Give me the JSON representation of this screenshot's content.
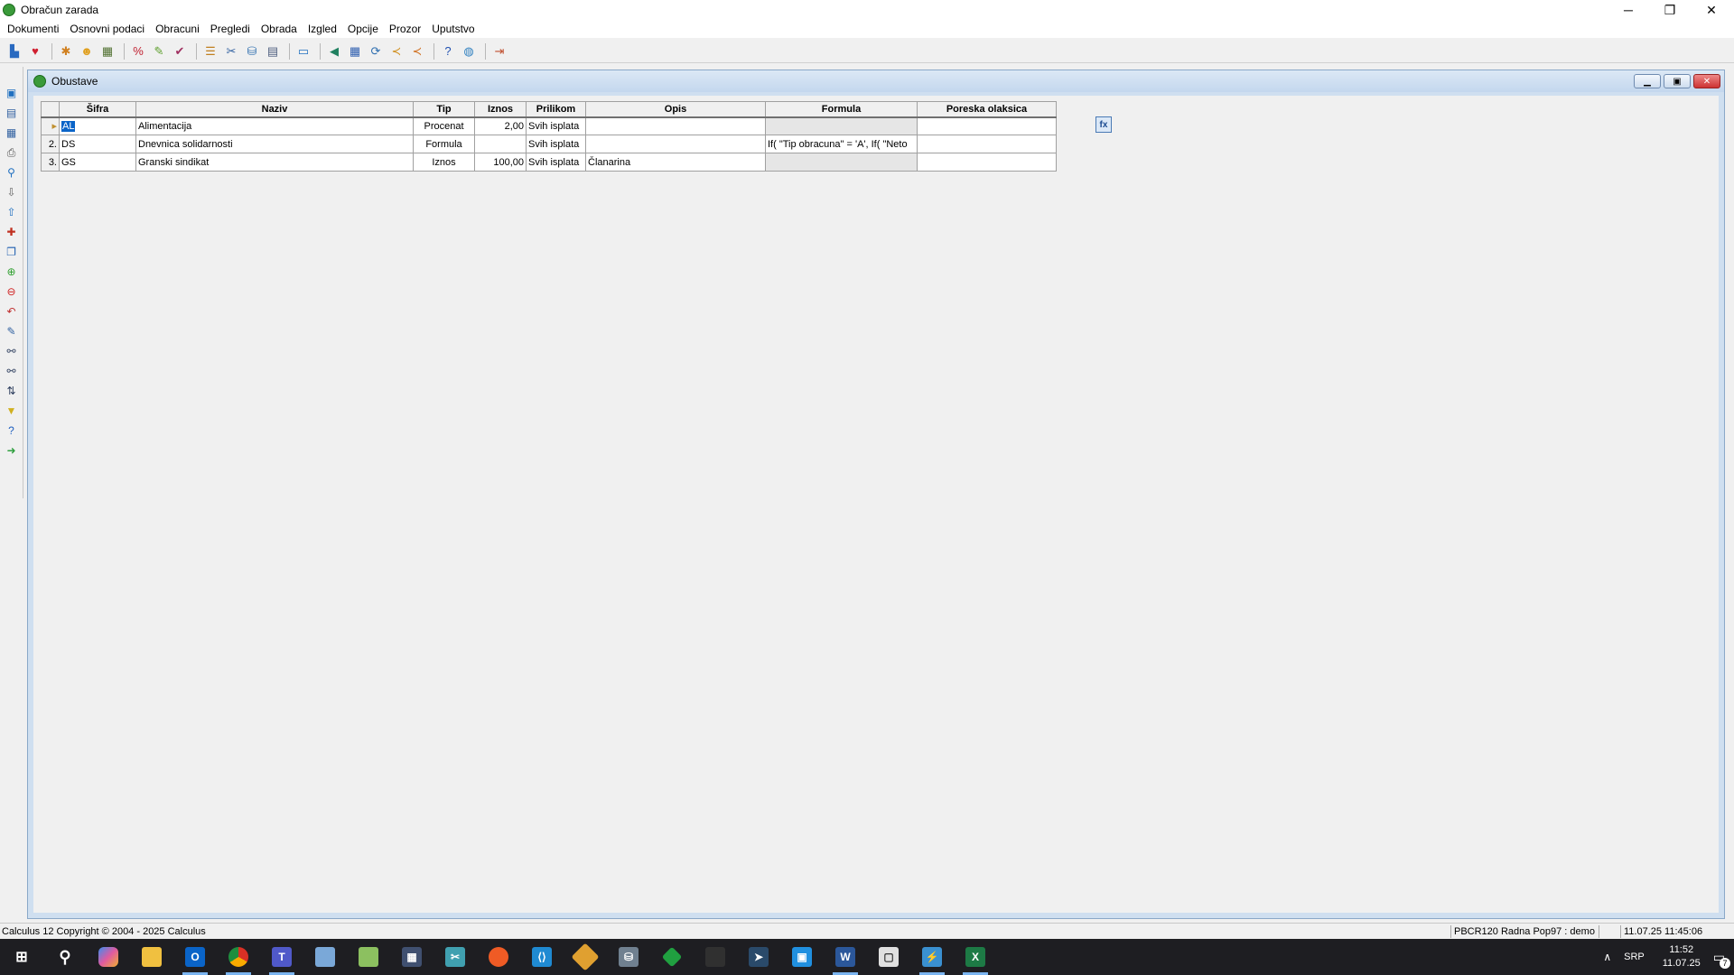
{
  "window": {
    "title": "Obračun zarada",
    "minimize_icon": "─",
    "restore_icon": "❐",
    "close_icon": "✕"
  },
  "menu": [
    "Dokumenti",
    "Osnovni podaci",
    "Obracuni",
    "Pregledi",
    "Obrada",
    "Izgled",
    "Opcije",
    "Prozor",
    "Uputstvo"
  ],
  "child_window": {
    "title": "Obustave",
    "columns": [
      "Šifra",
      "Naziv",
      "Tip",
      "Iznos",
      "Prilikom",
      "Opis",
      "Formula",
      "Poreska olaksica"
    ],
    "rows": [
      {
        "num": "",
        "sifra": "AL",
        "naziv": "Alimentacija",
        "tip": "Procenat",
        "iznos": "2,00",
        "prilikom": "Svih isplata",
        "opis": "",
        "formula": "",
        "poreska": ""
      },
      {
        "num": "2.",
        "sifra": "DS",
        "naziv": "Dnevnica solidarnosti",
        "tip": "Formula",
        "iznos": "",
        "prilikom": "Svih isplata",
        "opis": "",
        "formula": "If(  \"Tip obracuna\" = 'A', If(  \"Neto",
        "poreska": ""
      },
      {
        "num": "3.",
        "sifra": "GS",
        "naziv": "Granski sindikat",
        "tip": "Iznos",
        "iznos": "100,00",
        "prilikom": "Svih isplata",
        "opis": "Članarina",
        "formula": "",
        "poreska": ""
      }
    ],
    "fx_label": "fx"
  },
  "statusbar": {
    "left": "Calculus 12  Copyright © 2004 - 2025  Calculus",
    "db": "PBCR120 Radna Pop97 : demo",
    "datetime": "11.07.25 11:45:06"
  },
  "taskbar": {
    "lang": "SRP",
    "time": "11:52",
    "date": "11.07.25",
    "notifications": "7"
  },
  "colors": {
    "accent": "#0a64c8",
    "child_title": "#cfdff0",
    "taskbar": "#1e1e22"
  }
}
